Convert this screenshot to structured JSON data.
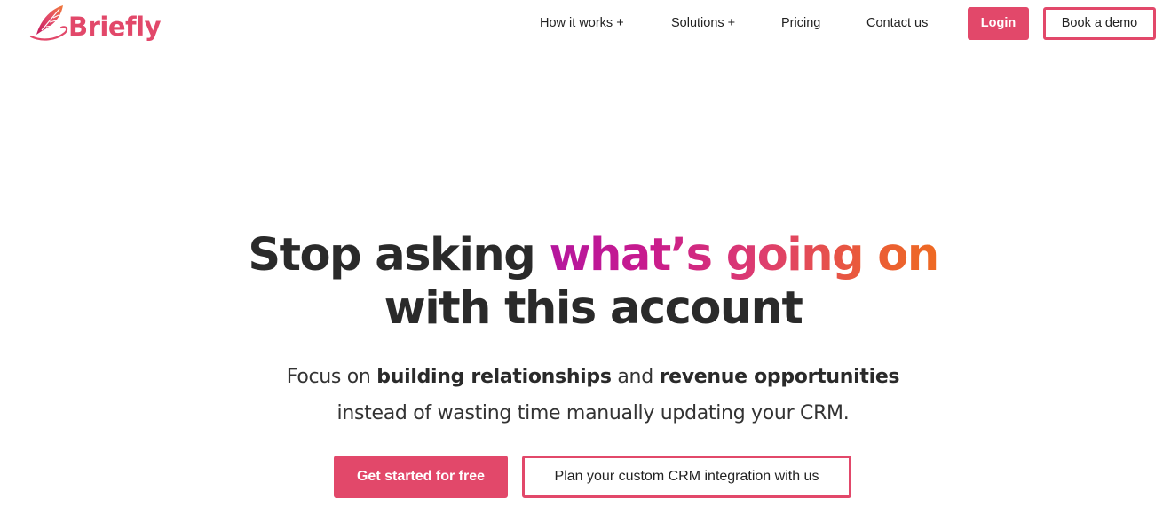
{
  "brand": {
    "name": "Briefly",
    "color": "#e2486a",
    "logo_icon": "feather-icon"
  },
  "nav": {
    "items": [
      {
        "label": "How it works +"
      },
      {
        "label": "Solutions +"
      },
      {
        "label": "Pricing"
      },
      {
        "label": "Contact us"
      }
    ],
    "login_label": "Login",
    "demo_label": "Book a demo"
  },
  "hero": {
    "title_part1": "Stop asking ",
    "title_highlight": "what’s going on",
    "title_part2": "with this account",
    "sub_part1": "Focus on ",
    "sub_bold1": "building relationships",
    "sub_part2": " and ",
    "sub_bold2": "revenue opportunities",
    "sub_line2": "instead of wasting time manually updating your CRM.",
    "primary_cta": "Get started for free",
    "secondary_cta": "Plan your custom CRM integration with us",
    "gradient_colors": [
      "#b5179e",
      "#de3e6e",
      "#ee6a22"
    ]
  }
}
